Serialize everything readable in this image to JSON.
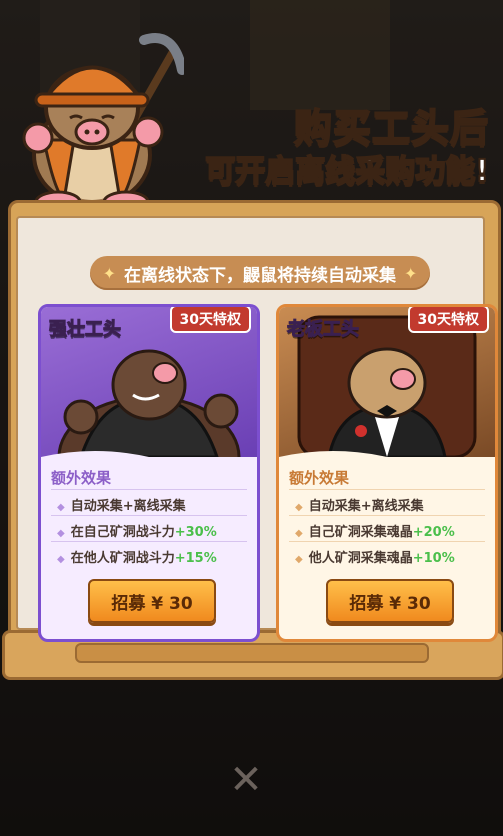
{
  "header": {
    "title_prefix": "购买",
    "title_highlight": "工头",
    "title_suffix": "后",
    "subtitle": "可开启离线采购功能!"
  },
  "banner": {
    "star": "✦",
    "text": "在离线状态下，鼹鼠将持续自动采集"
  },
  "cards": [
    {
      "name": "强壮工头",
      "tag": "30天特权",
      "effect_title": "额外效果",
      "effects": [
        {
          "text": "自动采集+离线采集",
          "plus": ""
        },
        {
          "text": "在自己矿洞战斗力",
          "plus": "+30%"
        },
        {
          "text": "在他人矿洞战斗力",
          "plus": "+15%"
        }
      ],
      "button": "招募 ¥ 30"
    },
    {
      "name": "老板工头",
      "tag": "30天特权",
      "effect_title": "额外效果",
      "effects": [
        {
          "text": "自动采集+离线采集",
          "plus": ""
        },
        {
          "text": "自己矿洞采集魂晶",
          "plus": "+20%"
        },
        {
          "text": "他人矿洞采集魂晶",
          "plus": "+10%"
        }
      ],
      "button": "招募 ¥ 30"
    }
  ],
  "colors": {
    "accent_purple": "#7c4fcf",
    "accent_orange": "#e0883a",
    "bonus_green": "#4bbf4b",
    "tag_red": "#c23a2e"
  },
  "icons": {
    "mascot": "mole-miner-with-pickaxe",
    "bottom": "close-x-icon"
  }
}
